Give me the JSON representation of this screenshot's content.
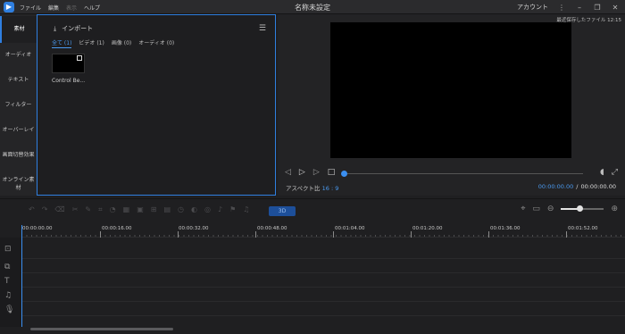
{
  "titlebar": {
    "menu": [
      "ファイル",
      "編集",
      "表示",
      "ヘルプ"
    ],
    "title": "名称未設定",
    "account": "アカウント"
  },
  "library": {
    "tabs": [
      "素材",
      "オーディオ",
      "テキスト",
      "フィルター",
      "オーバーレイ",
      "画面切替効果",
      "オンライン素材"
    ],
    "import_label": "インポート",
    "filters": [
      "全て (1)",
      "ビデオ (1)",
      "画像 (0)",
      "オーディオ (0)"
    ],
    "media": [
      {
        "name": "Control Be..."
      }
    ]
  },
  "preview": {
    "autosave": "最近保存したファイル 12:15",
    "aspect_label": "アスペクト比",
    "aspect_value": "16 : 9",
    "current_time": "00:00:00.00",
    "separator": "/",
    "total_time": "00:00:00.00"
  },
  "timeline": {
    "threed_label": "3D",
    "ruler_labels": [
      "00:00:00.00",
      "00:00:16.00",
      "00:00:32.00",
      "00:00:48.00",
      "00:01:04.00",
      "00:01:20.00",
      "00:01:36.00",
      "00:01:52.00"
    ]
  }
}
